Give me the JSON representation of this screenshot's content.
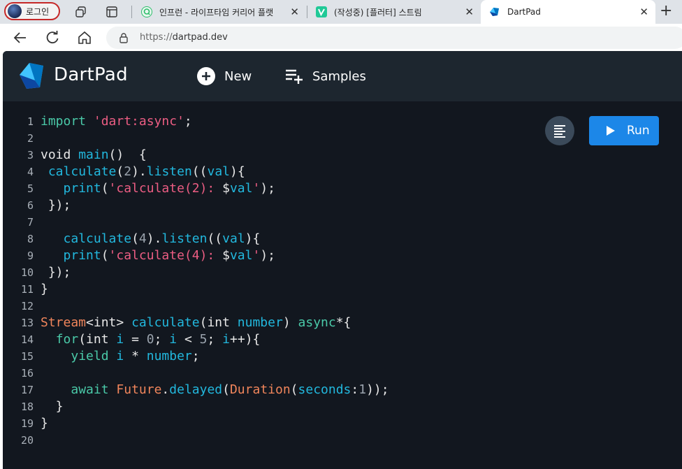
{
  "browser": {
    "profile_label": "로그인",
    "tabs": [
      {
        "title": "인프런 - 라이프타임 커리어 플랫",
        "close": "✕"
      },
      {
        "title": "(작성중) [플러터] 스트림",
        "close": "✕"
      },
      {
        "title": "DartPad",
        "close": "✕"
      }
    ],
    "new_tab": "+",
    "url_scheme": "https://",
    "url_host": "dartpad.dev"
  },
  "app": {
    "name": "DartPad",
    "new_label": "New",
    "samples_label": "Samples",
    "run_label": "Run"
  },
  "colors": {
    "keyword": "#4ac9a8",
    "string": "#ec5d83",
    "function": "#22b8de",
    "type": "#f0855b",
    "plain": "#e8e8e8",
    "number": "#9aa3ad",
    "run": "#1c87e8"
  },
  "code_lines": [
    [
      [
        "import ",
        "keyword"
      ],
      [
        "'dart:async'",
        "string"
      ],
      [
        ";",
        "plain"
      ]
    ],
    [],
    [
      [
        "void ",
        "plain"
      ],
      [
        "main",
        "function"
      ],
      [
        "()  {",
        "plain"
      ]
    ],
    [
      [
        " ",
        "plain"
      ],
      [
        "calculate",
        "function"
      ],
      [
        "(",
        "plain"
      ],
      [
        "2",
        "number"
      ],
      [
        ").",
        "plain"
      ],
      [
        "listen",
        "function"
      ],
      [
        "((",
        "plain"
      ],
      [
        "val",
        "function"
      ],
      [
        "){",
        "plain"
      ]
    ],
    [
      [
        "   ",
        "plain"
      ],
      [
        "print",
        "function"
      ],
      [
        "(",
        "plain"
      ],
      [
        "'calculate(2): ",
        "string"
      ],
      [
        "$",
        "plain"
      ],
      [
        "val",
        "function"
      ],
      [
        "'",
        "string"
      ],
      [
        ");",
        "plain"
      ]
    ],
    [
      [
        " });",
        "plain"
      ]
    ],
    [],
    [
      [
        "   ",
        "plain"
      ],
      [
        "calculate",
        "function"
      ],
      [
        "(",
        "plain"
      ],
      [
        "4",
        "number"
      ],
      [
        ").",
        "plain"
      ],
      [
        "listen",
        "function"
      ],
      [
        "((",
        "plain"
      ],
      [
        "val",
        "function"
      ],
      [
        "){",
        "plain"
      ]
    ],
    [
      [
        "   ",
        "plain"
      ],
      [
        "print",
        "function"
      ],
      [
        "(",
        "plain"
      ],
      [
        "'calculate(4): ",
        "string"
      ],
      [
        "$",
        "plain"
      ],
      [
        "val",
        "function"
      ],
      [
        "'",
        "string"
      ],
      [
        ");",
        "plain"
      ]
    ],
    [
      [
        " });",
        "plain"
      ]
    ],
    [
      [
        "}",
        "plain"
      ]
    ],
    [],
    [
      [
        "Stream",
        "type"
      ],
      [
        "<int> ",
        "plain"
      ],
      [
        "calculate",
        "function"
      ],
      [
        "(int ",
        "plain"
      ],
      [
        "number",
        "function"
      ],
      [
        ") ",
        "plain"
      ],
      [
        "async",
        "keyword"
      ],
      [
        "*{",
        "plain"
      ]
    ],
    [
      [
        "  ",
        "plain"
      ],
      [
        "for",
        "keyword"
      ],
      [
        "(int ",
        "plain"
      ],
      [
        "i",
        "function"
      ],
      [
        " = ",
        "plain"
      ],
      [
        "0",
        "number"
      ],
      [
        "; ",
        "plain"
      ],
      [
        "i",
        "function"
      ],
      [
        " < ",
        "plain"
      ],
      [
        "5",
        "number"
      ],
      [
        "; ",
        "plain"
      ],
      [
        "i",
        "function"
      ],
      [
        "++){",
        "plain"
      ]
    ],
    [
      [
        "    ",
        "plain"
      ],
      [
        "yield ",
        "keyword"
      ],
      [
        "i",
        "function"
      ],
      [
        " * ",
        "plain"
      ],
      [
        "number",
        "function"
      ],
      [
        ";",
        "plain"
      ]
    ],
    [],
    [
      [
        "    ",
        "plain"
      ],
      [
        "await ",
        "keyword"
      ],
      [
        "Future",
        "type"
      ],
      [
        ".",
        "plain"
      ],
      [
        "delayed",
        "function"
      ],
      [
        "(",
        "plain"
      ],
      [
        "Duration",
        "type"
      ],
      [
        "(",
        "plain"
      ],
      [
        "seconds",
        "function"
      ],
      [
        ":",
        "plain"
      ],
      [
        "1",
        "number"
      ],
      [
        "));",
        "plain"
      ]
    ],
    [
      [
        "  }",
        "plain"
      ]
    ],
    [
      [
        "}",
        "plain"
      ]
    ],
    []
  ],
  "line_numbers": [
    "1",
    "2",
    "3",
    "4",
    "5",
    "6",
    "7",
    "8",
    "9",
    "10",
    "11",
    "12",
    "13",
    "14",
    "15",
    "16",
    "17",
    "18",
    "19",
    "20"
  ]
}
